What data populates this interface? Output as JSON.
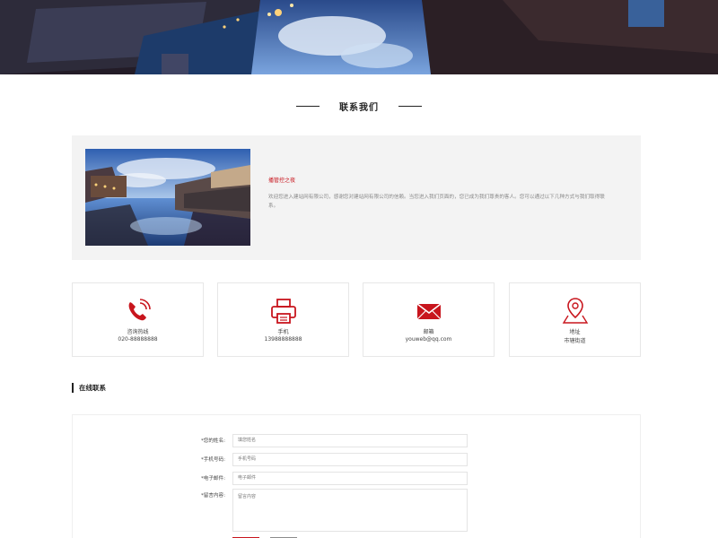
{
  "section_title": "联系我们",
  "intro": {
    "heading": "播管控之夜",
    "body": "欢迎您进入建站网有限公司，感谢您对建站网有限公司的信赖。当您进入我们页面的，您已成为我们尊贵的客人。您可以通过以下几种方式与我们取得联系。"
  },
  "cards": [
    {
      "icon": "phone-icon",
      "label": "咨询热线",
      "value": "020-88888888"
    },
    {
      "icon": "printer-icon",
      "label": "手机",
      "value": "13988888888"
    },
    {
      "icon": "mail-icon",
      "label": "邮箱",
      "value": "youweb@qq.com"
    },
    {
      "icon": "map-pin-icon",
      "label": "地址",
      "value": "市辖街道"
    }
  ],
  "online_contact": {
    "title": "在线联系",
    "fields": [
      {
        "label": "*您的姓名:",
        "placeholder": "填您姓名"
      },
      {
        "label": "*手机号码:",
        "placeholder": "手机号码"
      },
      {
        "label": "*电子邮件:",
        "placeholder": "电子邮件"
      },
      {
        "label": "*留言内容:",
        "placeholder": "留言内容"
      }
    ]
  },
  "colors": {
    "accent": "#c8151d",
    "panel_bg": "#f3f3f3",
    "secondary_button": "#8c8c8c"
  }
}
